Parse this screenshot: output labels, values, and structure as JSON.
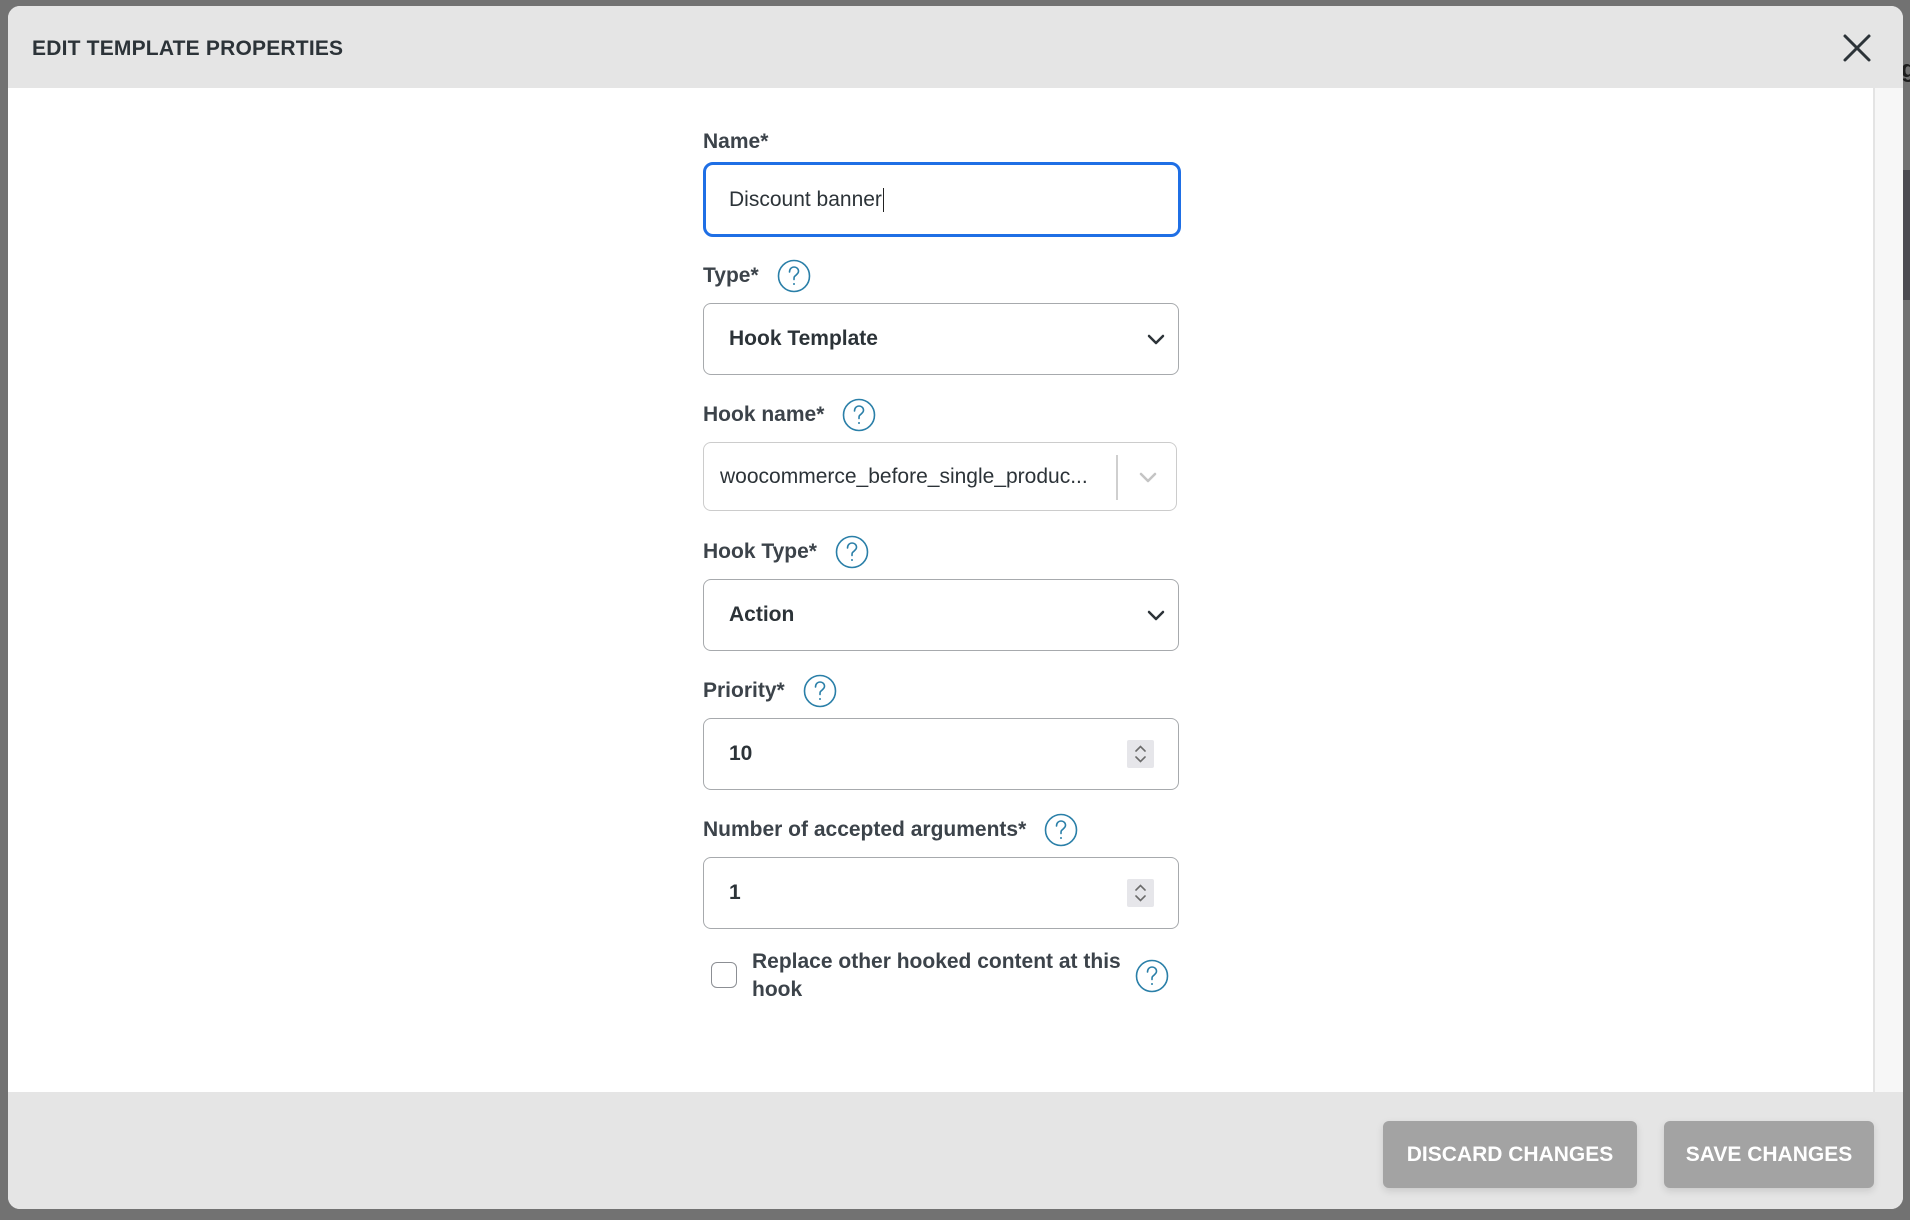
{
  "dialog": {
    "title": "EDIT TEMPLATE PROPERTIES",
    "close_icon": "close-icon"
  },
  "form": {
    "name": {
      "label": "Name*",
      "value": "Discount banner"
    },
    "type": {
      "label": "Type*",
      "value": "Hook Template",
      "help_icon": "help-icon"
    },
    "hook_name": {
      "label": "Hook name*",
      "value": "woocommerce_before_single_produc...",
      "help_icon": "help-icon"
    },
    "hook_type": {
      "label": "Hook Type*",
      "value": "Action",
      "help_icon": "help-icon"
    },
    "priority": {
      "label": "Priority*",
      "value": "10",
      "help_icon": "help-icon"
    },
    "accepted_args": {
      "label": "Number of accepted arguments*",
      "value": "1",
      "help_icon": "help-icon"
    },
    "replace_hooked": {
      "label": "Replace other hooked content at this hook",
      "checked": false,
      "help_icon": "help-icon"
    }
  },
  "footer": {
    "discard_label": "DISCARD CHANGES",
    "save_label": "SAVE CHANGES"
  },
  "colors": {
    "focus_border": "#1f6fe5",
    "help_icon": "#2a7fa8",
    "button_bg": "#a3a3a3",
    "header_bg": "#e5e5e5"
  }
}
